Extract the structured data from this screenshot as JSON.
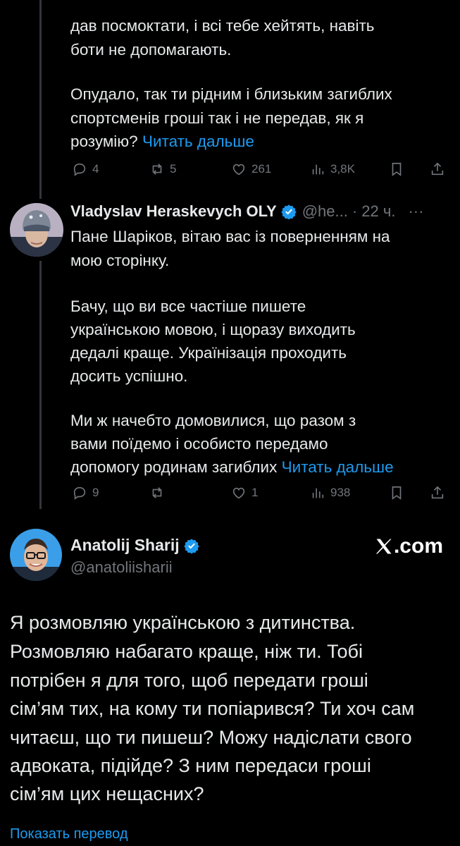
{
  "tweet1": {
    "lines": [
      "дав посмоктати, і всі тебе хейтять, навіть",
      "боти не допомагають.",
      "",
      "Опудало, так ти рідним і близьким загиблих",
      "спортсменів гроші так і не передав, як я"
    ],
    "last_line": "розумію?",
    "read_more": "Читать дальше",
    "replies": "4",
    "reposts": "5",
    "likes": "261",
    "views": "3,8K"
  },
  "tweet2": {
    "author_name": "Vladyslav Heraskevych OLY",
    "handle": "@he...",
    "time": "· 22 ч.",
    "more": "···",
    "lines": [
      "Пане Шаріков, вітаю вас із поверненням на",
      "мою сторінку.",
      "",
      "Бачу, що ви все частіше пишете",
      "українською мовою, і щоразу виходить",
      "дедалі краще. Українізація проходить",
      "досить успішно.",
      "",
      "Ми ж начебто домовилися, що разом з",
      "вами поїдемо і особисто передамо"
    ],
    "last_line": "допомогу родинам загиблих",
    "read_more": "Читать дальше",
    "replies": "9",
    "reposts": "",
    "likes": "1",
    "views": "938"
  },
  "tweet3": {
    "author_name": "Anatolij Sharij",
    "handle": "@anatoliisharii",
    "brand": ".com",
    "lines": [
      "Я розмовляю українською з дитинства.",
      "Розмовляю набагато краще, ніж ти. Тобі",
      "потрібен я для того, щоб передати гроші",
      "сім’ям тих, на кому ти попіарився? Ти хоч сам",
      "читаєш, що ти пишеш? Можу надіслати свого",
      "адвоката, підійде? З ним передаси гроші",
      "сім’ям цих нещасних?"
    ],
    "translate": "Показать перевод"
  },
  "colors": {
    "link": "#1d9bf0",
    "muted": "#71767b",
    "background": "#000000",
    "text": "#e7e9ea",
    "verified": "#1d9bf0"
  }
}
